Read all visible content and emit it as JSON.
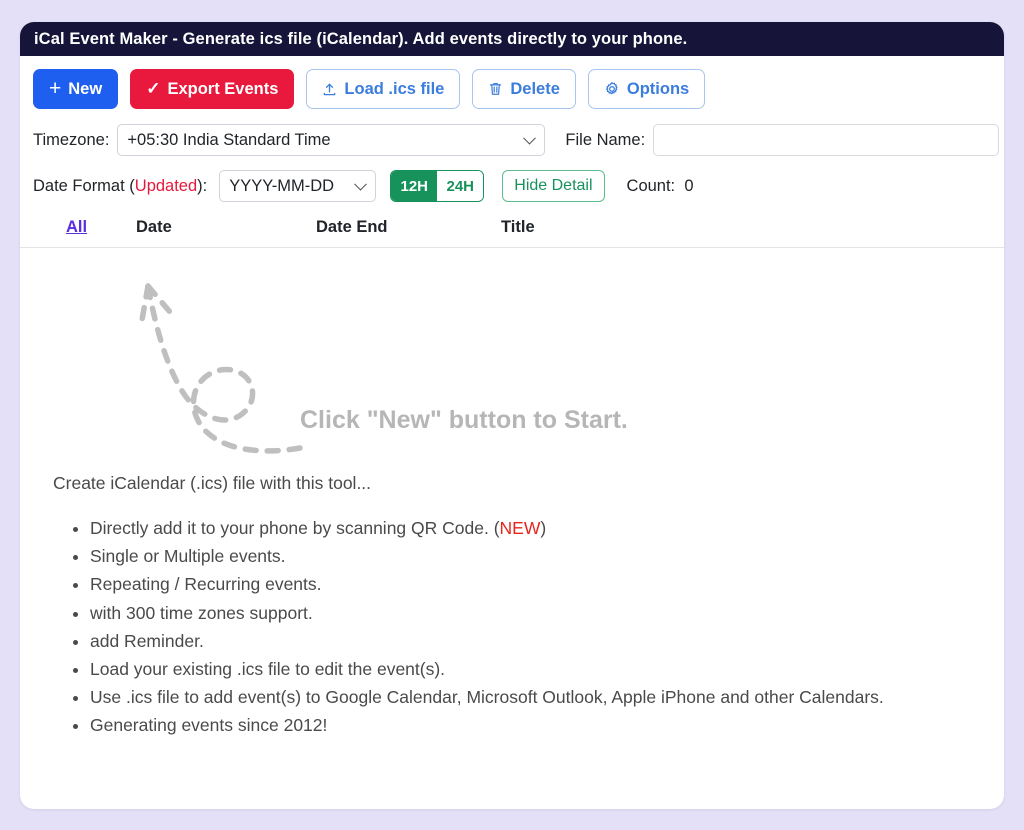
{
  "window": {
    "title": "iCal Event Maker - Generate ics file (iCalendar). Add events directly to your phone.",
    "titlebar_bg": "#161438",
    "page_bg": "#e4e0f8"
  },
  "toolbar": {
    "new_label": "New",
    "new_icon": "plus-icon",
    "new_color": "#1f5ff0",
    "export_label": "Export Events",
    "export_icon": "check-icon",
    "export_color": "#e8193c",
    "load_label": "Load .ics file",
    "load_icon": "upload-icon",
    "delete_label": "Delete",
    "delete_icon": "trash-icon",
    "options_label": "Options",
    "options_icon": "gear-icon",
    "outline_color": "#3b7ddd"
  },
  "timezone_row": {
    "label": "Timezone:",
    "value": "+05:30 India Standard Time",
    "filename_label": "File Name:",
    "filename_value": "",
    "filename_placeholder": ""
  },
  "dateformat_row": {
    "label_prefix": "Date Format (",
    "label_updated": "Updated",
    "label_suffix": "):",
    "updated_color": "#e8193c",
    "value": "YYYY-MM-DD",
    "time_12h": "12H",
    "time_24h": "24H",
    "time_active": "12H",
    "toggle_color": "#17925b",
    "hide_detail_label": "Hide Detail",
    "count_label": "Count:",
    "count_value": "0"
  },
  "table": {
    "headers": {
      "all": "All",
      "date": "Date",
      "date_end": "Date End",
      "title": "Title"
    },
    "all_link_color": "#5b2ee0",
    "rows": []
  },
  "empty_state": {
    "message": "Click \"New\" button to Start.",
    "arrow_icon": "curved-dashed-arrow-icon",
    "text_color": "#b6b6b6"
  },
  "info": {
    "lead": "Create iCalendar (.ics) file with this tool...",
    "bullets": [
      {
        "text": "Directly add it to your phone by scanning QR Code. (",
        "tag": "NEW",
        "tail": ")"
      },
      {
        "text": "Single or Multiple events.",
        "tag": "",
        "tail": ""
      },
      {
        "text": "Repeating / Recurring events.",
        "tag": "",
        "tail": ""
      },
      {
        "text": "with 300 time zones support.",
        "tag": "",
        "tail": ""
      },
      {
        "text": "add Reminder.",
        "tag": "",
        "tail": ""
      },
      {
        "text": "Load your existing .ics file to edit the event(s).",
        "tag": "",
        "tail": ""
      },
      {
        "text": "Use .ics file to add event(s) to Google Calendar, Microsoft Outlook, Apple iPhone and other Calendars.",
        "tag": "",
        "tail": ""
      },
      {
        "text": "Generating events since 2012!",
        "tag": "",
        "tail": ""
      }
    ],
    "new_tag_color": "#e8241c"
  }
}
